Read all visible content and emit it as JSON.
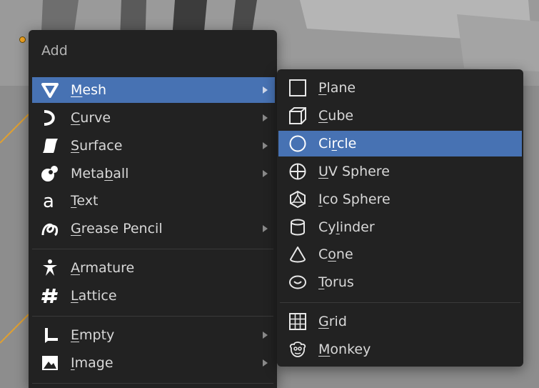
{
  "menu": {
    "title": "Add",
    "items": [
      {
        "pre": "",
        "u": "M",
        "post": "esh",
        "icon": "mesh-icon",
        "submenu": true,
        "active": true
      },
      {
        "pre": "",
        "u": "C",
        "post": "urve",
        "icon": "curve-icon",
        "submenu": true,
        "active": false
      },
      {
        "pre": "",
        "u": "S",
        "post": "urface",
        "icon": "surface-icon",
        "submenu": true,
        "active": false
      },
      {
        "pre": "Meta",
        "u": "b",
        "post": "all",
        "icon": "metaball-icon",
        "submenu": true,
        "active": false
      },
      {
        "pre": "",
        "u": "T",
        "post": "ext",
        "icon": "text-icon",
        "submenu": false,
        "active": false
      },
      {
        "pre": "",
        "u": "G",
        "post": "rease Pencil",
        "icon": "grease-pencil-icon",
        "submenu": true,
        "active": false
      },
      {
        "pre": "",
        "u": "A",
        "post": "rmature",
        "icon": "armature-icon",
        "submenu": false,
        "active": false
      },
      {
        "pre": "",
        "u": "L",
        "post": "attice",
        "icon": "lattice-icon",
        "submenu": false,
        "active": false
      },
      {
        "pre": "",
        "u": "E",
        "post": "mpty",
        "icon": "empty-icon",
        "submenu": true,
        "active": false
      },
      {
        "pre": "",
        "u": "I",
        "post": "mage",
        "icon": "image-icon",
        "submenu": true,
        "active": false
      }
    ]
  },
  "submenu": {
    "items": [
      {
        "pre": "",
        "u": "P",
        "post": "lane",
        "icon": "plane-icon",
        "active": false
      },
      {
        "pre": "",
        "u": "C",
        "post": "ube",
        "icon": "cube-icon",
        "active": false
      },
      {
        "pre": "Ci",
        "u": "r",
        "post": "cle",
        "icon": "circle-icon",
        "active": true
      },
      {
        "pre": "",
        "u": "U",
        "post": "V Sphere",
        "icon": "uv-sphere-icon",
        "active": false
      },
      {
        "pre": "",
        "u": "I",
        "post": "co Sphere",
        "icon": "ico-sphere-icon",
        "active": false
      },
      {
        "pre": "Cy",
        "u": "l",
        "post": "inder",
        "icon": "cylinder-icon",
        "active": false
      },
      {
        "pre": "C",
        "u": "o",
        "post": "ne",
        "icon": "cone-icon",
        "active": false
      },
      {
        "pre": "",
        "u": "T",
        "post": "orus",
        "icon": "torus-icon",
        "active": false
      },
      {
        "pre": "",
        "u": "G",
        "post": "rid",
        "icon": "grid-icon",
        "active": false
      },
      {
        "pre": "",
        "u": "M",
        "post": "onkey",
        "icon": "monkey-icon",
        "active": false
      }
    ]
  },
  "colors": {
    "menu_bg": "#222222",
    "highlight": "#4772b3",
    "text": "#d8d8d8",
    "viewport_bg": "#8c8c8c",
    "origin": "#f5a623"
  }
}
